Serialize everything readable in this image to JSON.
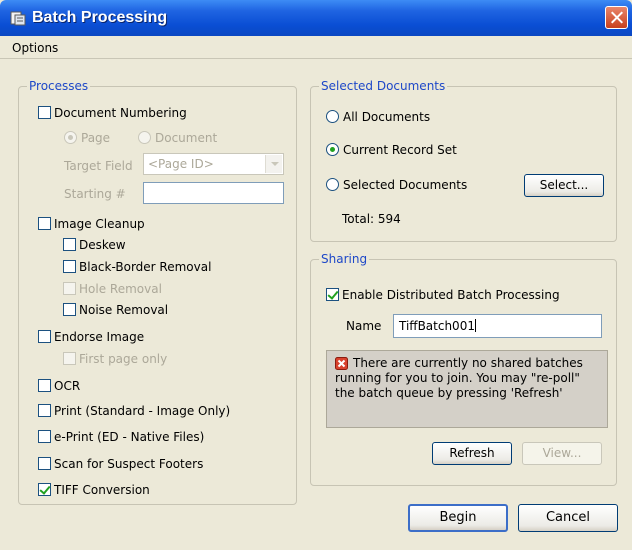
{
  "window": {
    "title": "Batch Processing"
  },
  "menu": {
    "options": "Options"
  },
  "processes": {
    "title": "Processes",
    "document_numbering": "Document Numbering",
    "page": "Page",
    "document": "Document",
    "target_field_label": "Target Field",
    "target_field_value": "<Page ID>",
    "starting_label": "Starting #",
    "image_cleanup": "Image Cleanup",
    "deskew": "Deskew",
    "black_border": "Black-Border Removal",
    "hole_removal": "Hole Removal",
    "noise_removal": "Noise Removal",
    "endorse_image": "Endorse Image",
    "first_page_only": "First page only",
    "ocr": "OCR",
    "print": "Print  (Standard - Image Only)",
    "eprint": "e-Print (ED - Native Files)",
    "scan_footers": "Scan for Suspect Footers",
    "tiff_conversion": "TIFF Conversion"
  },
  "selected_documents": {
    "title": "Selected Documents",
    "all_documents": "All Documents",
    "current_record_set": "Current Record Set",
    "selected_documents": "Selected Documents",
    "select_button": "Select...",
    "total": "Total:  594"
  },
  "sharing": {
    "title": "Sharing",
    "enable_distributed": "Enable Distributed Batch Processing",
    "name_label": "Name",
    "name_value": "TiffBatch001",
    "info": "There are currently no shared batches running for you to join.  You may \"re-poll\" the batch queue by pressing 'Refresh'",
    "refresh": "Refresh",
    "view": "View..."
  },
  "footer": {
    "begin": "Begin",
    "cancel": "Cancel"
  },
  "colors": {
    "title_bar": "#0a4ed4",
    "group_title": "#1e48c8",
    "check": "#21a121",
    "disabled_text": "#aca899"
  }
}
